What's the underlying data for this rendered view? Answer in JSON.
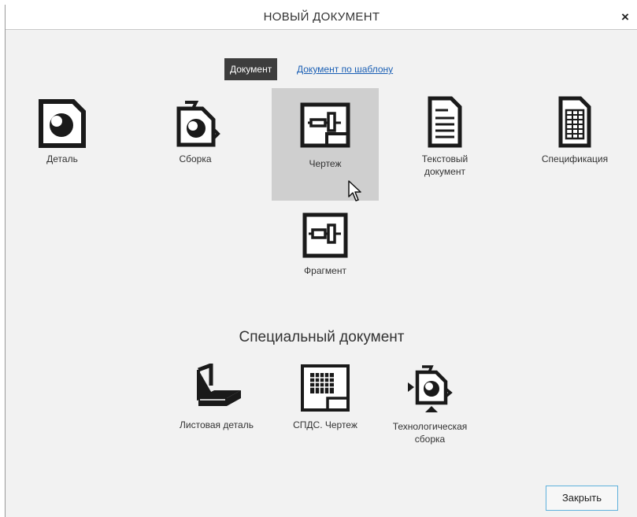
{
  "window": {
    "title": "НОВЫЙ ДОКУМЕНТ",
    "close_glyph": "×"
  },
  "tabs": {
    "active": "Документ",
    "link": "Документ по шаблону"
  },
  "documents": [
    {
      "label": "Деталь",
      "icon": "part-icon"
    },
    {
      "label": "Сборка",
      "icon": "assembly-icon"
    },
    {
      "label": "Чертеж",
      "icon": "drawing-icon",
      "highlighted": true
    },
    {
      "label": "Текстовый документ",
      "icon": "text-document-icon"
    },
    {
      "label": "Спецификация",
      "icon": "specification-icon"
    },
    {
      "label": "Фрагмент",
      "icon": "fragment-icon"
    }
  ],
  "special": {
    "title": "Специальный документ",
    "items": [
      {
        "label": "Листовая деталь",
        "icon": "sheet-part-icon"
      },
      {
        "label": "СПДС. Чертеж",
        "icon": "spds-drawing-icon"
      },
      {
        "label": "Технологическая сборка",
        "icon": "tech-assembly-icon"
      }
    ]
  },
  "footer": {
    "close_label": "Закрыть"
  },
  "colors": {
    "tab_active_bg": "#3d3d3d",
    "link": "#1a5fb4",
    "highlight": "#cfcfcf",
    "button_border": "#5fb1dc"
  }
}
